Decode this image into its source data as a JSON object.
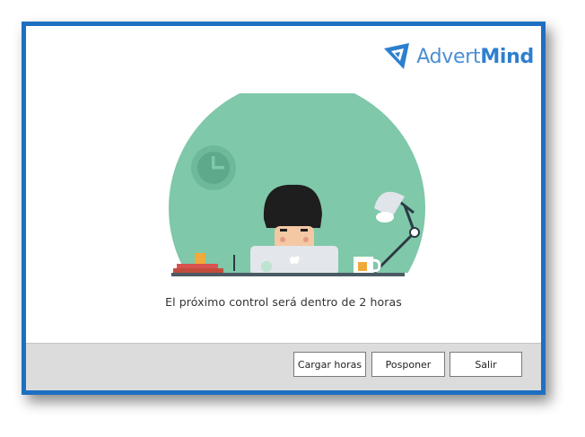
{
  "brand": {
    "name_part1": "Advert",
    "name_part2": "Mind",
    "accent_color": "#1f6fc1",
    "logo_icon": "advertmind-logo-icon"
  },
  "illustration": {
    "icon": "person-at-laptop-illustration",
    "circle_color": "#7fc8a9"
  },
  "message": "El próximo control será dentro de 2 horas",
  "buttons": {
    "load_hours": "Cargar horas",
    "postpone": "Posponer",
    "exit": "Salir"
  }
}
